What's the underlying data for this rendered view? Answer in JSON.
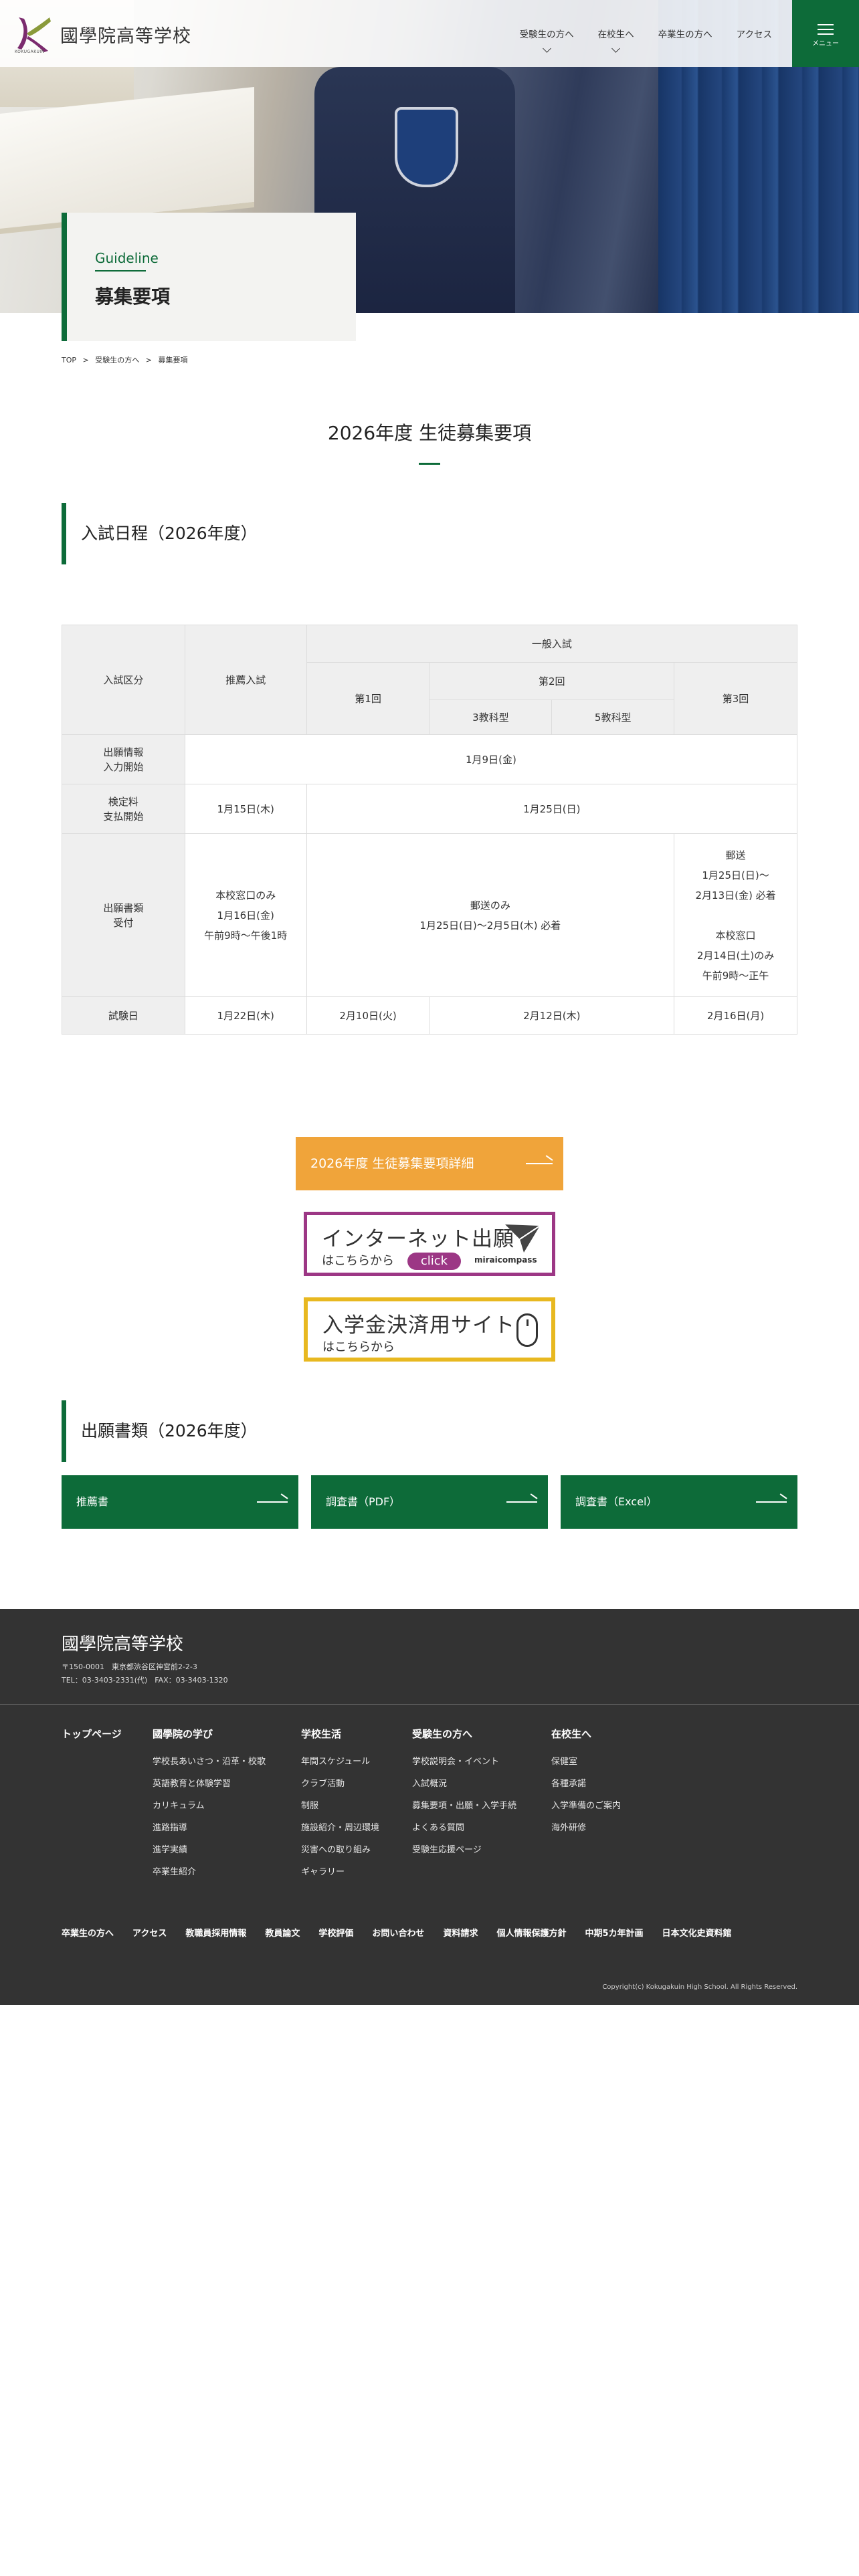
{
  "header": {
    "logo_text": "國學院高等学校",
    "logo_sub": "KOKUGAKUIN",
    "nav": [
      {
        "label": "受験生の方へ",
        "dropdown": true
      },
      {
        "label": "在校生へ",
        "dropdown": true
      },
      {
        "label": "卒業生の方へ",
        "dropdown": false
      },
      {
        "label": "アクセス",
        "dropdown": false
      }
    ],
    "menu_label": "メニュー",
    "accent": "#0d6b39"
  },
  "hero": {
    "en": "Guideline",
    "ja": "募集要項"
  },
  "breadcrumb": [
    "TOP",
    ">",
    "受験生の方へ",
    ">",
    "募集要項"
  ],
  "page": {
    "title": "2026年度 生徒募集要項",
    "section1": "入試日程（2026年度）",
    "section2": "出願書類（2026年度）"
  },
  "schedule": {
    "h_kubun": "入試区分",
    "h_suisen": "推薦入試",
    "h_ippan": "一般入試",
    "h_r1": "第1回",
    "h_r2": "第2回",
    "h_r3": "第3回",
    "h_3kyoka": "3教科型",
    "h_5kyoka": "5教科型",
    "row1_label": "出願情報\n入力開始",
    "row1_val": "1月9日(金)",
    "row2_label": "検定料\n支払開始",
    "row2_suisen": "1月15日(木)",
    "row2_ippan": "1月25日(日)",
    "row3_label": "出願書類\n受付",
    "row3_suisen": "本校窓口のみ\n1月16日(金)\n午前9時～午後1時",
    "row3_r12": "郵送のみ\n1月25日(日)～2月5日(木) 必着",
    "row3_r3": "郵送\n1月25日(日)～\n2月13日(金) 必着\n\n本校窓口\n2月14日(土)のみ\n午前9時～正午",
    "row4_label": "試験日",
    "row4_suisen": "1月22日(木)",
    "row4_r1": "2月10日(火)",
    "row4_r2": "2月12日(木)",
    "row4_r3": "2月16日(月)"
  },
  "buttons": {
    "detail": "2026年度 生徒募集要項詳細",
    "net_big": "インターネット出願",
    "net_small": "はこちらから",
    "net_click": "click",
    "net_brand": "miraicompass",
    "pay_big": "入学金決済用サイト",
    "pay_small": "はこちらから",
    "docs": [
      "推薦書",
      "調査書（PDF）",
      "調査書（Excel）"
    ]
  },
  "footer": {
    "name": "國學院高等学校",
    "address": "〒150-0001　東京都渋谷区神宮前2-2-3",
    "tel": "TEL：03-3403-2331(代)　FAX：03-3403-1320",
    "cols": [
      {
        "head": "トップページ",
        "items": []
      },
      {
        "head": "國學院の学び",
        "items": [
          "学校長あいさつ・沿革・校歌",
          "英語教育と体験学習",
          "カリキュラム",
          "進路指導",
          "進学実績",
          "卒業生紹介"
        ]
      },
      {
        "head": "学校生活",
        "items": [
          "年間スケジュール",
          "クラブ活動",
          "制服",
          "施設紹介・周辺環境",
          "災害への取り組み",
          "ギャラリー"
        ]
      },
      {
        "head": "受験生の方へ",
        "items": [
          "学校説明会・イベント",
          "入試概況",
          "募集要項・出願・入学手続",
          "よくある質問",
          "受験生応援ページ"
        ]
      },
      {
        "head": "在校生へ",
        "items": [
          "保健室",
          "各種承諾",
          "入学準備のご案内",
          "海外研修"
        ]
      }
    ],
    "links": [
      "卒業生の方へ",
      "アクセス",
      "教職員採用情報",
      "教員論文",
      "学校評価",
      "お問い合わせ",
      "資料請求",
      "個人情報保護方針",
      "中期5カ年計画",
      "日本文化史資料館"
    ],
    "copyright": "Copyright(c) Kokugakuin High School. All Rights Reserved."
  }
}
